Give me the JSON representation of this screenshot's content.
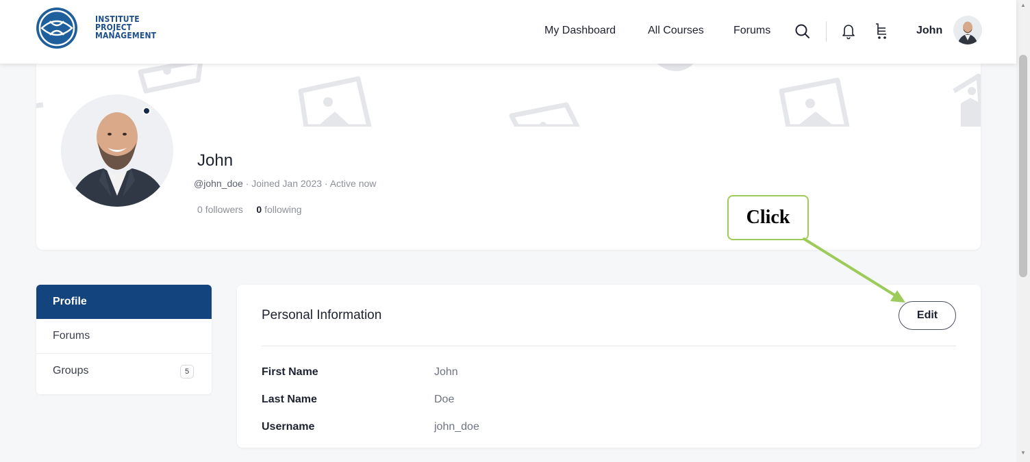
{
  "header": {
    "logo_lines": [
      "INSTITUTE",
      "PROJECT",
      "MANAGEMENT"
    ],
    "nav": [
      "My Dashboard",
      "All Courses",
      "Forums"
    ],
    "user_name": "John",
    "icons": [
      "search-icon",
      "bell-icon",
      "cart-icon"
    ]
  },
  "profile": {
    "name": "John",
    "handle": "@john_doe",
    "meta": " · Joined Jan 2023 · Active now",
    "followers_count": "0",
    "followers_label": "followers",
    "following_count": "0",
    "following_label": "following"
  },
  "sidebar": {
    "items": [
      {
        "label": "Profile",
        "active": true
      },
      {
        "label": "Forums"
      },
      {
        "label": "Groups",
        "badge": "5"
      }
    ]
  },
  "personal_info": {
    "title": "Personal Information",
    "edit_label": "Edit",
    "fields": [
      {
        "label": "First Name",
        "value": "John"
      },
      {
        "label": "Last Name",
        "value": "Doe"
      },
      {
        "label": "Username",
        "value": "john_doe"
      }
    ]
  },
  "annotation": {
    "callout_text": "Click"
  },
  "colors": {
    "brand_blue": "#13447d",
    "logo_blue": "#1f5f9c",
    "callout_green": "#9ccb5a"
  }
}
